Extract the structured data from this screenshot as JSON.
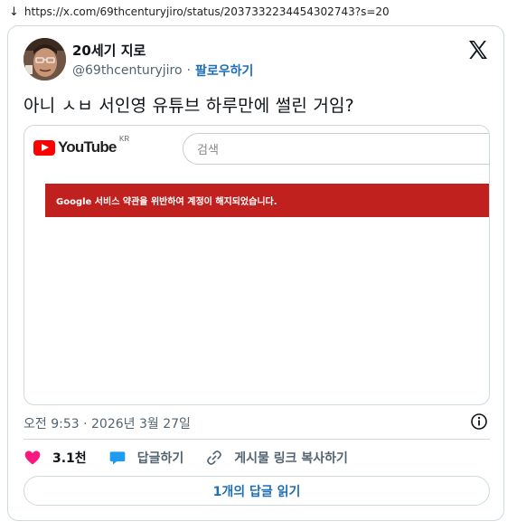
{
  "browser": {
    "url": "https://x.com/69thcenturyjiro/status/2037332234454302743?s=20",
    "arrow": "↓"
  },
  "author": {
    "display_name": "20세기 지로",
    "handle": "@69thcenturyjiro",
    "separator": "·",
    "follow_label": "팔로우하기"
  },
  "tweet": {
    "text": "아니 ㅅㅂ 서인영 유튜브 하루만에 썰린 거임?"
  },
  "media": {
    "brand": "YouTube",
    "region": "KR",
    "search_placeholder": "검색",
    "banner_text": "Google 서비스 약관을 위반하여 계정이 해지되었습니다.",
    "banner_color": "#c0211f"
  },
  "meta": {
    "timestamp": "오전 9:53 · 2026년 3월 27일"
  },
  "actions": {
    "likes": "3.1천",
    "reply_label": "답글하기",
    "copy_link_label": "게시물 링크 복사하기"
  },
  "read_replies": {
    "label": "1개의 답글 읽기"
  },
  "colors": {
    "link": "#1d6fb8",
    "heart": "#f91880",
    "reply_bubble": "#1d9bf0"
  }
}
